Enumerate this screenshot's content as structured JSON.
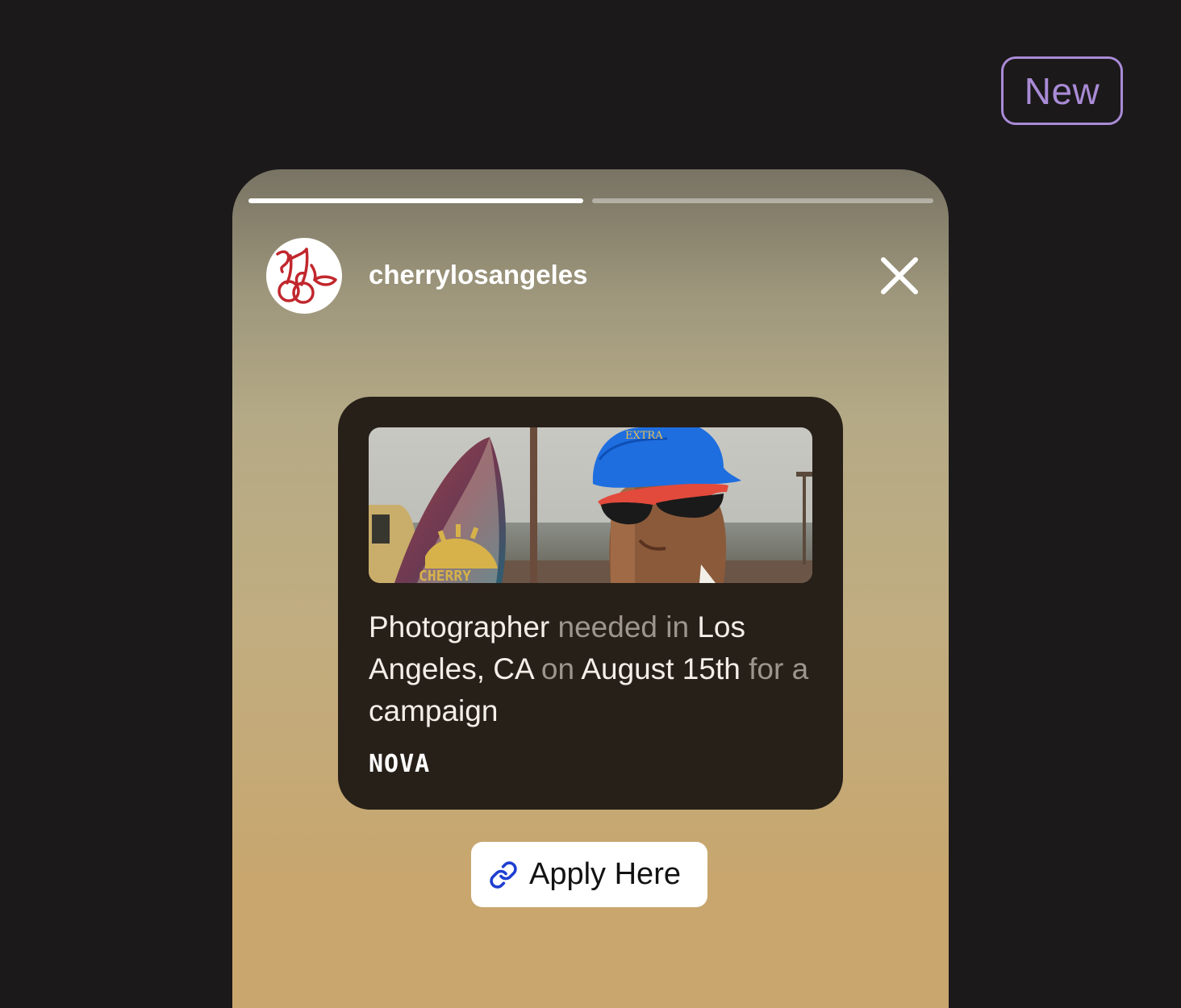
{
  "badge": {
    "label": "New"
  },
  "story": {
    "progress": [
      1.0,
      0.0
    ],
    "username": "cherrylosangeles",
    "avatar_icon": "cherry-logo-icon",
    "close_icon": "close-icon"
  },
  "card": {
    "image_alt": "Man in blue cap and red sunglasses beside a CHERRY surfboard at the beach",
    "surfboard_text": "CHERRY",
    "cap_text": "EXTRA",
    "text": {
      "w1": "Photographer",
      "w2": "needed in",
      "w3": "Los Angeles, CA",
      "w4": "on",
      "w5": "August 15th",
      "w6": "for",
      "w7": "a",
      "w8": "campaign"
    },
    "brand": "NOVA"
  },
  "apply": {
    "label": "Apply Here",
    "icon": "link-icon"
  },
  "colors": {
    "background": "#1b191a",
    "badge_accent": "#a98bd6",
    "card_bg": "#272019",
    "link_icon": "#1f3fd1"
  }
}
